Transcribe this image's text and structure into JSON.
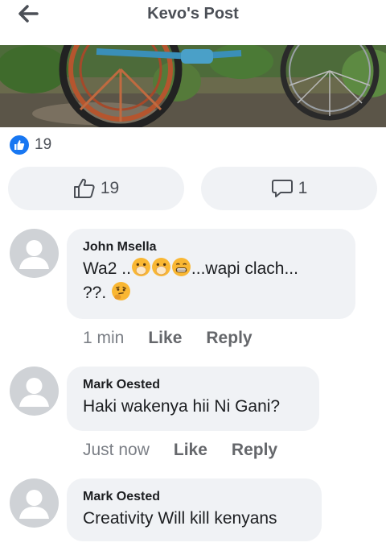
{
  "header": {
    "title": "Kevo's Post"
  },
  "post": {
    "reaction_count": "19",
    "like_count": "19",
    "comment_count": "1"
  },
  "comments": [
    {
      "author": "John Msella",
      "text_prefix": "Wa2  ..",
      "text_mid": "...wapi clach...",
      "text_line2": "??.",
      "emojis": [
        "hand-over-mouth-emoji",
        "hand-over-mouth-emoji",
        "grimacing-emoji",
        "thinking-emoji"
      ],
      "time": "1 min",
      "like_label": "Like",
      "reply_label": "Reply"
    },
    {
      "author": "Mark Oested",
      "text": "Haki wakenya hii Ni Gani?",
      "time": "Just now",
      "like_label": "Like",
      "reply_label": "Reply"
    },
    {
      "author": "Mark Oested",
      "text": "Creativity Will kill kenyans"
    }
  ],
  "colors": {
    "accent": "#1877f2",
    "bubble": "#f0f2f5",
    "muted": "#65676b"
  }
}
